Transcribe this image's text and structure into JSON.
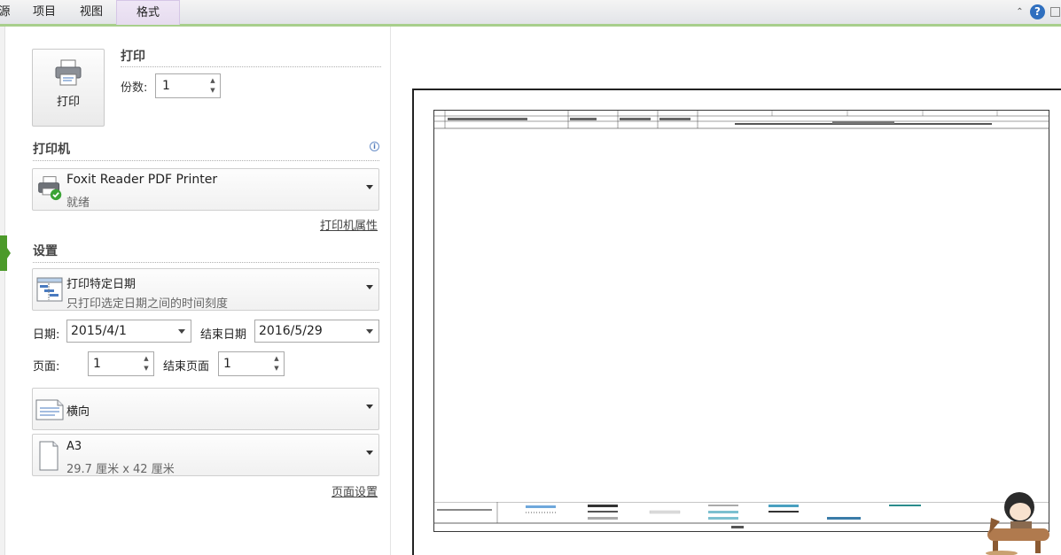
{
  "ribbon": {
    "tabs": [
      {
        "label": "源"
      },
      {
        "label": "项目"
      },
      {
        "label": "视图"
      },
      {
        "label": "格式"
      }
    ]
  },
  "print": {
    "section_title": "打印",
    "button_label": "打印",
    "copies_label": "份数:",
    "copies_value": "1"
  },
  "printer": {
    "section_title": "打印机",
    "name": "Foxit Reader PDF Printer",
    "status": "就绪",
    "properties_link": "打印机属性"
  },
  "settings": {
    "section_title": "设置",
    "range": {
      "title": "打印特定日期",
      "subtitle": "只打印选定日期之间的时间刻度"
    },
    "date_label": "日期:",
    "date_value": "2015/4/1",
    "end_date_label": "结束日期",
    "end_date_value": "2016/5/29",
    "page_label": "页面:",
    "page_value": "1",
    "end_page_label": "结束页面",
    "end_page_value": "1",
    "orientation": "横向",
    "paper": {
      "title": "A3",
      "subtitle": "29.7 厘米 x 42 厘米"
    },
    "page_setup_link": "页面设置"
  },
  "icons": {
    "left_marker_color": "#4c9a2a",
    "help_color": "#2f6fbf"
  }
}
